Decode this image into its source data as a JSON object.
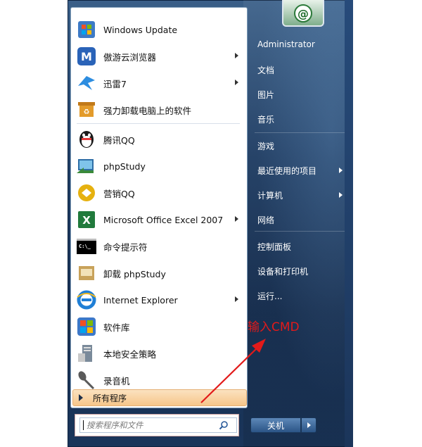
{
  "programs": [
    {
      "label": "Windows Update",
      "icon": "windows-update-icon",
      "arrow": false,
      "color": "#3d7ac6"
    },
    {
      "label": "傲游云浏览器",
      "icon": "maxthon-browser-icon",
      "arrow": true,
      "color": "#2a63b8"
    },
    {
      "label": "迅雷7",
      "icon": "thunder-bird-icon",
      "arrow": true,
      "color": "#2d8de0"
    },
    {
      "label": "强力卸载电脑上的软件",
      "icon": "uninstall-box-icon",
      "arrow": false,
      "color": "#e39b2b"
    },
    {
      "label": "腾讯QQ",
      "icon": "qq-penguin-icon",
      "arrow": false,
      "color": "#1a1a1a"
    },
    {
      "label": "phpStudy",
      "icon": "phpstudy-icon",
      "arrow": false,
      "color": "#3a8a3a"
    },
    {
      "label": "营销QQ",
      "icon": "marketing-qq-icon",
      "arrow": false,
      "color": "#e6b10f"
    },
    {
      "label": "Microsoft Office Excel 2007",
      "icon": "excel-icon",
      "arrow": true,
      "color": "#217a3c"
    },
    {
      "label": "命令提示符",
      "icon": "cmd-icon",
      "arrow": false,
      "color": "#000000"
    },
    {
      "label": "卸载 phpStudy",
      "icon": "uninstall-phpstudy-icon",
      "arrow": false,
      "color": "#c8a25a"
    },
    {
      "label": "Internet Explorer",
      "icon": "internet-explorer-icon",
      "arrow": true,
      "color": "#1f7fd6"
    },
    {
      "label": "软件库",
      "icon": "software-library-icon",
      "arrow": false,
      "color": "#3c78c8"
    },
    {
      "label": "本地安全策略",
      "icon": "security-policy-icon",
      "arrow": false,
      "color": "#7a8a9a"
    },
    {
      "label": "录音机",
      "icon": "microphone-icon",
      "arrow": false,
      "color": "#5a5a5a"
    }
  ],
  "all_programs": "所有程序",
  "search": {
    "placeholder": "搜索程序和文件"
  },
  "right_items": [
    {
      "label": "Administrator",
      "arrow": false
    },
    {
      "label": "文档",
      "arrow": false
    },
    {
      "label": "图片",
      "arrow": false
    },
    {
      "label": "音乐",
      "arrow": false
    },
    {
      "label": "游戏",
      "arrow": false
    },
    {
      "label": "最近使用的项目",
      "arrow": true
    },
    {
      "label": "计算机",
      "arrow": true
    },
    {
      "label": "网络",
      "arrow": false
    },
    {
      "label": "控制面板",
      "arrow": false
    },
    {
      "label": "设备和打印机",
      "arrow": false
    },
    {
      "label": "运行...",
      "arrow": false
    }
  ],
  "shutdown_label": "关机",
  "annotation": "输入CMD",
  "colors": {
    "annotation": "#e21a1a",
    "menu_dark": "#1f3e66",
    "all_programs_bg": "#f6c68a"
  }
}
